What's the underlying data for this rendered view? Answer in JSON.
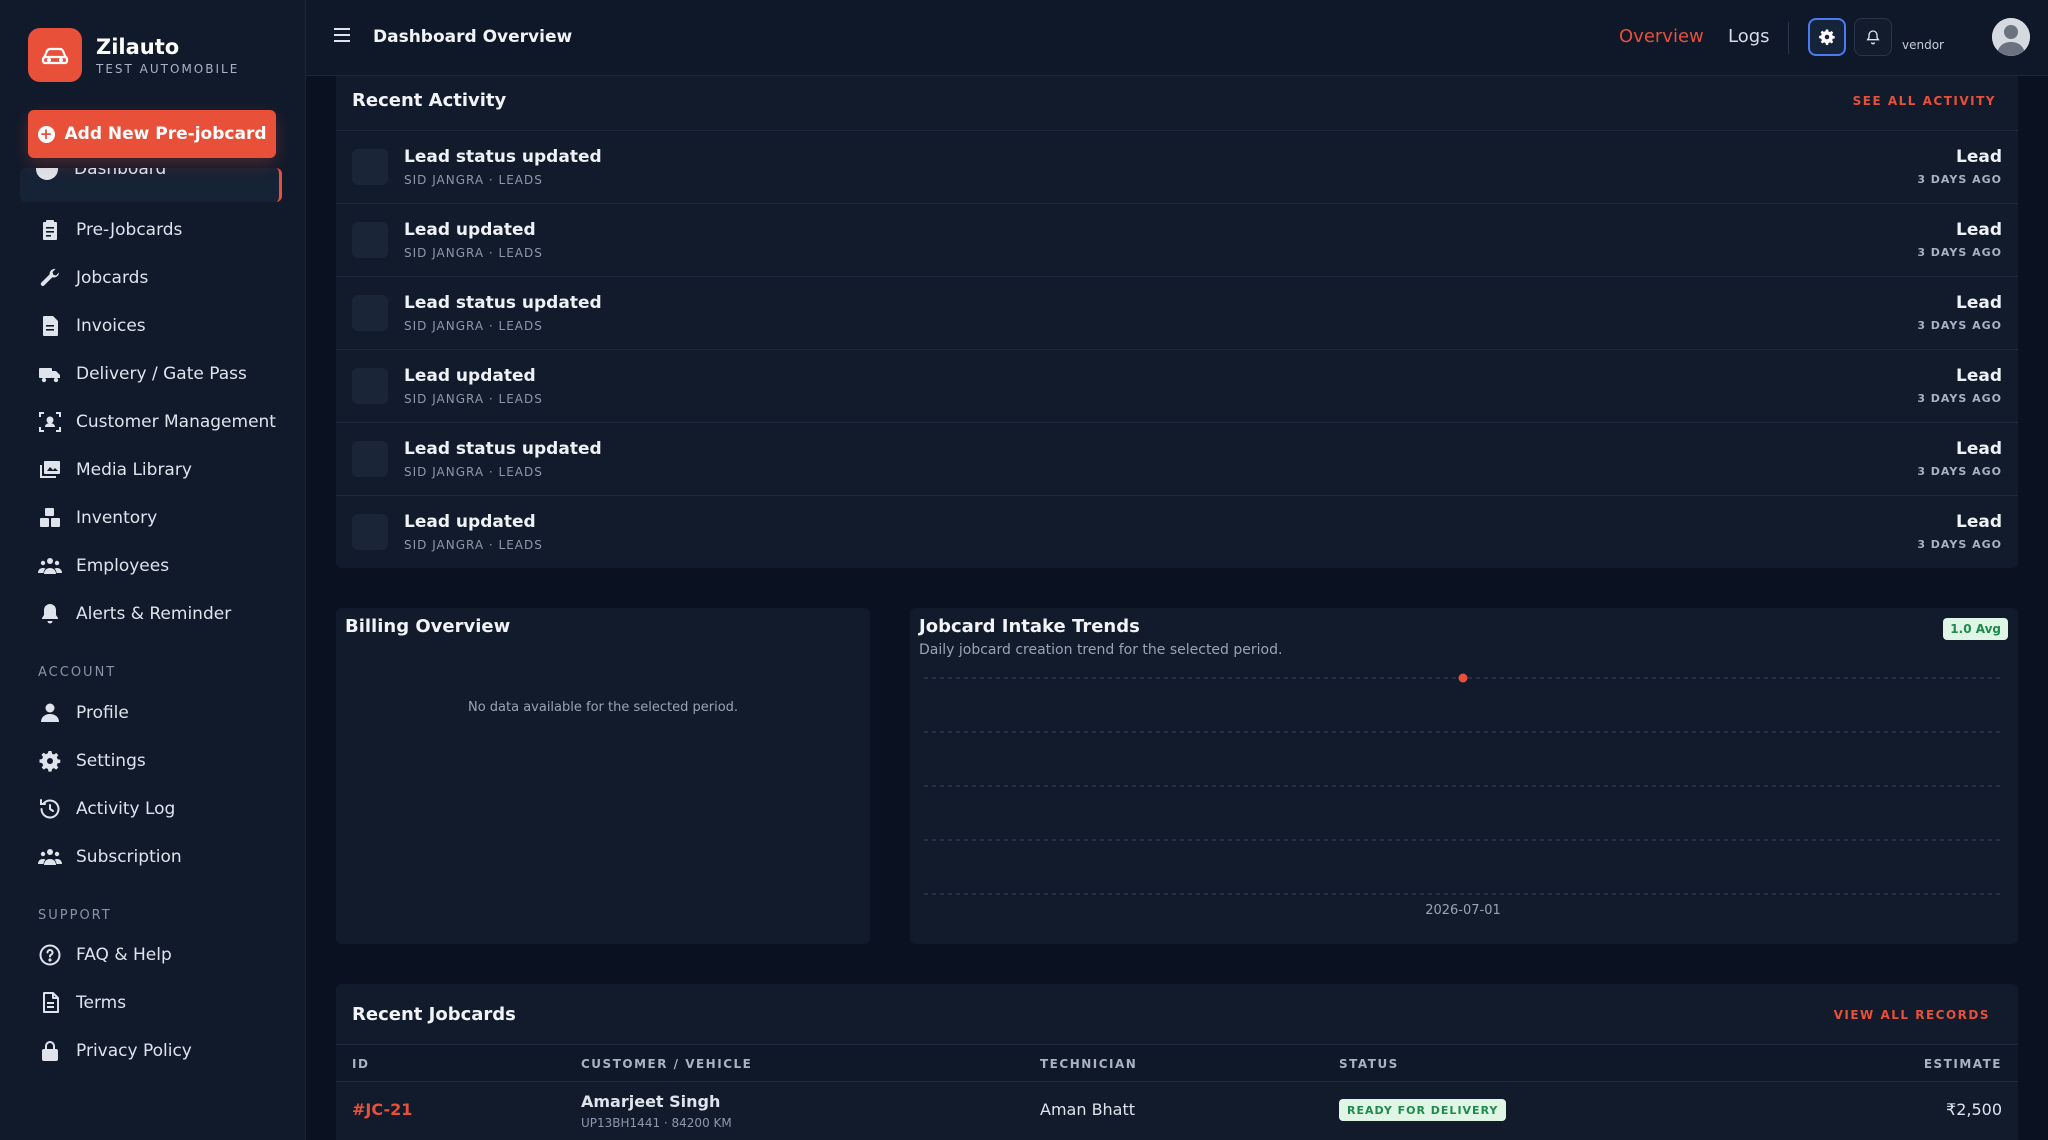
{
  "brand": {
    "name": "Zilauto",
    "subtitle": "TEST AUTOMOBILE"
  },
  "sidebar": {
    "add_button": "Add New Pre-jobcard",
    "active_item": "Dashboard",
    "items": [
      {
        "label": "Pre-Jobcards",
        "icon": "clipboard-icon"
      },
      {
        "label": "Jobcards",
        "icon": "wrench-icon"
      },
      {
        "label": "Invoices",
        "icon": "invoice-icon"
      },
      {
        "label": "Delivery / Gate Pass",
        "icon": "truck-icon"
      },
      {
        "label": "Customer Management",
        "icon": "users-scan-icon"
      },
      {
        "label": "Media Library",
        "icon": "images-icon"
      },
      {
        "label": "Inventory",
        "icon": "boxes-icon"
      },
      {
        "label": "Employees",
        "icon": "people-icon"
      },
      {
        "label": "Alerts & Reminder",
        "icon": "bell-icon"
      }
    ],
    "account_label": "ACCOUNT",
    "account_items": [
      {
        "label": "Profile",
        "icon": "user-icon"
      },
      {
        "label": "Settings",
        "icon": "gear-icon"
      },
      {
        "label": "Activity Log",
        "icon": "history-icon"
      },
      {
        "label": "Subscription",
        "icon": "people-icon"
      }
    ],
    "support_label": "SUPPORT",
    "support_items": [
      {
        "label": "FAQ & Help",
        "icon": "help-icon"
      },
      {
        "label": "Terms",
        "icon": "document-icon"
      },
      {
        "label": "Privacy Policy",
        "icon": "lock-icon"
      }
    ]
  },
  "topbar": {
    "title": "Dashboard Overview",
    "links": [
      "Overview",
      "Logs"
    ],
    "user_role": "vendor"
  },
  "recent_activity": {
    "title": "Recent Activity",
    "see_all": "SEE ALL ACTIVITY",
    "rows": [
      {
        "title": "Lead status updated",
        "meta": "SID JANGRA · LEADS",
        "type": "Lead",
        "time": "3 DAYS AGO"
      },
      {
        "title": "Lead updated",
        "meta": "SID JANGRA · LEADS",
        "type": "Lead",
        "time": "3 DAYS AGO"
      },
      {
        "title": "Lead status updated",
        "meta": "SID JANGRA · LEADS",
        "type": "Lead",
        "time": "3 DAYS AGO"
      },
      {
        "title": "Lead updated",
        "meta": "SID JANGRA · LEADS",
        "type": "Lead",
        "time": "3 DAYS AGO"
      },
      {
        "title": "Lead status updated",
        "meta": "SID JANGRA · LEADS",
        "type": "Lead",
        "time": "3 DAYS AGO"
      },
      {
        "title": "Lead updated",
        "meta": "SID JANGRA · LEADS",
        "type": "Lead",
        "time": "3 DAYS AGO"
      }
    ]
  },
  "billing": {
    "title": "Billing Overview",
    "empty_message": "No data available for the selected period."
  },
  "trends": {
    "title": "Jobcard Intake Trends",
    "subtitle": "Daily jobcard creation trend for the selected period.",
    "badge": "1.0 Avg"
  },
  "chart_data": {
    "type": "line",
    "x": [
      "2026-07-01"
    ],
    "series": [
      {
        "values": [
          1
        ]
      }
    ],
    "ylim": [
      0,
      1
    ],
    "grid": true,
    "color": "#e8503a"
  },
  "recent_jobcards": {
    "title": "Recent Jobcards",
    "view_all": "VIEW ALL RECORDS",
    "columns": [
      "ID",
      "CUSTOMER / VEHICLE",
      "TECHNICIAN",
      "STATUS",
      "ESTIMATE"
    ],
    "rows": [
      {
        "id": "#JC-21",
        "customer": "Amarjeet Singh",
        "vehicle": "UP13BH1441 · 84200 KM",
        "technician": "Aman Bhatt",
        "status": "READY FOR DELIVERY",
        "estimate": "₹2,500"
      }
    ]
  },
  "colors": {
    "accent": "#e8503a",
    "success": "#1f8a4c",
    "focus": "#4a7bf0"
  }
}
